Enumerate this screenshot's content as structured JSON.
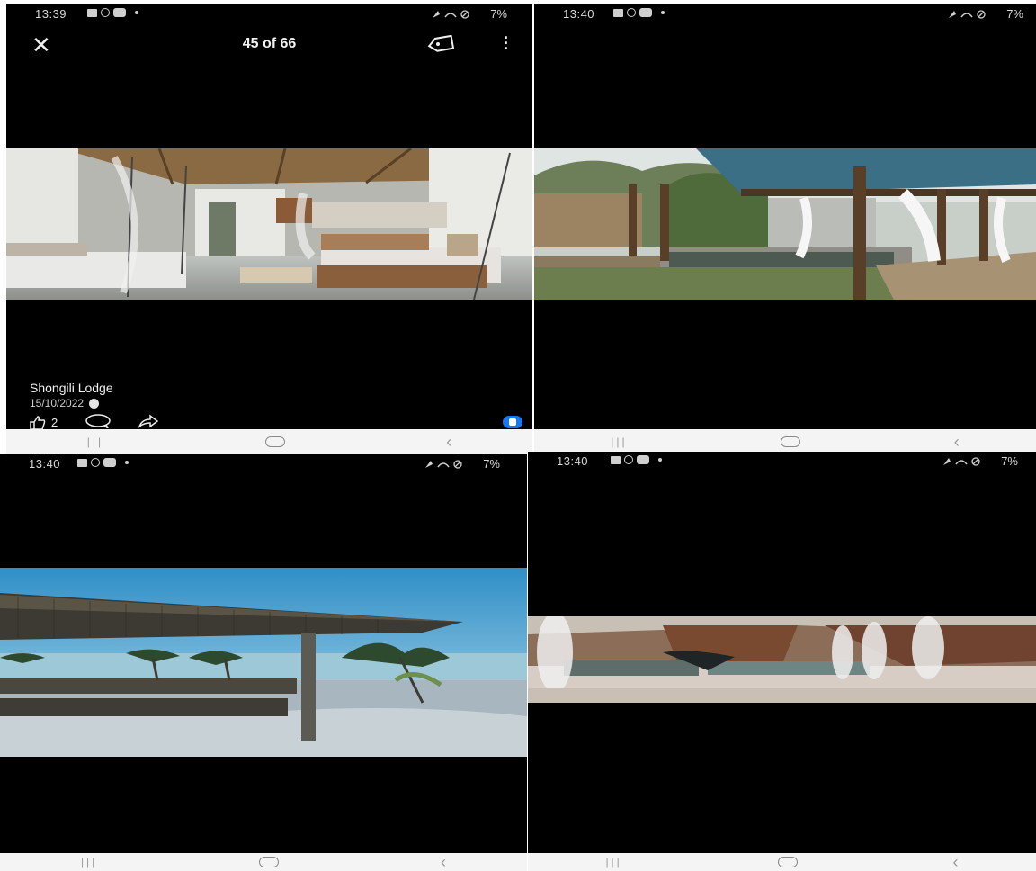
{
  "status_times": [
    "13:39",
    "13:40",
    "13:40",
    "13:40"
  ],
  "battery": "7%",
  "viewer": {
    "counter": "45 of 66",
    "caption_name": "Shongili Lodge",
    "caption_date": "15/10/2022",
    "like_count": "2"
  },
  "icons": {
    "close": "close-icon",
    "tag": "tag-icon",
    "more": "more-vertical-icon",
    "like": "like-icon",
    "comment": "comment-icon",
    "share": "share-icon",
    "globe": "globe-icon",
    "reaction": "like-reaction-icon"
  },
  "colors": {
    "background": "#000000",
    "navbar": "#f4f4f4",
    "reaction": "#1877f2"
  }
}
